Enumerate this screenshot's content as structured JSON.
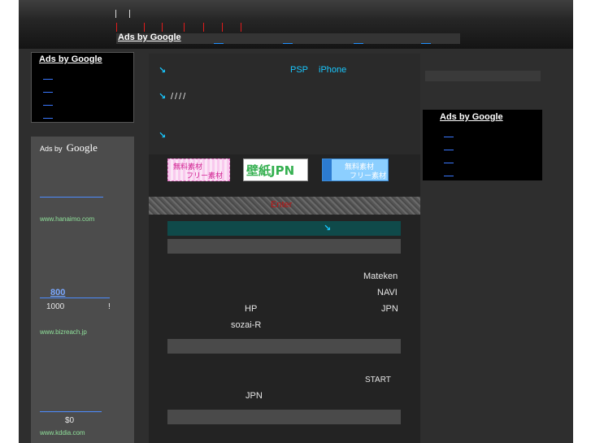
{
  "header": {
    "ads_label": "Ads by Google"
  },
  "left_top_ad": {
    "label": "Ads by Google"
  },
  "right_ad": {
    "label": "Ads by Google"
  },
  "left_column": {
    "ads_small": "Ads by",
    "ads_google": "Google",
    "url1": "www.hanaimo.com",
    "price_main": "800",
    "price_sub": "1000",
    "excl": "!",
    "url2": "www.bizreach.jp",
    "price3": "$0",
    "url3": "www.kddia.com"
  },
  "center": {
    "arrow": "↘",
    "psp": "PSP",
    "iphone": "iPhone",
    "slashes": "////",
    "banner1_line1": "無料素材",
    "banner1_line2": "フリー素材",
    "banner2": "壁紙JPN",
    "banner3_line1": "無料素材",
    "banner3_line2": "フリー素材",
    "enter": "Enter",
    "mateken": "Mateken",
    "navi": "NAVI",
    "hp": "HP",
    "jpn1": "JPN",
    "sozai": "sozai-R",
    "start": "START",
    "jpn2": "JPN"
  },
  "colors": {
    "accent_cyan": "#19c8ff",
    "link_green": "#8fe09a",
    "teal_bar": "#0f4a4a",
    "enter_red": "#c01010"
  }
}
